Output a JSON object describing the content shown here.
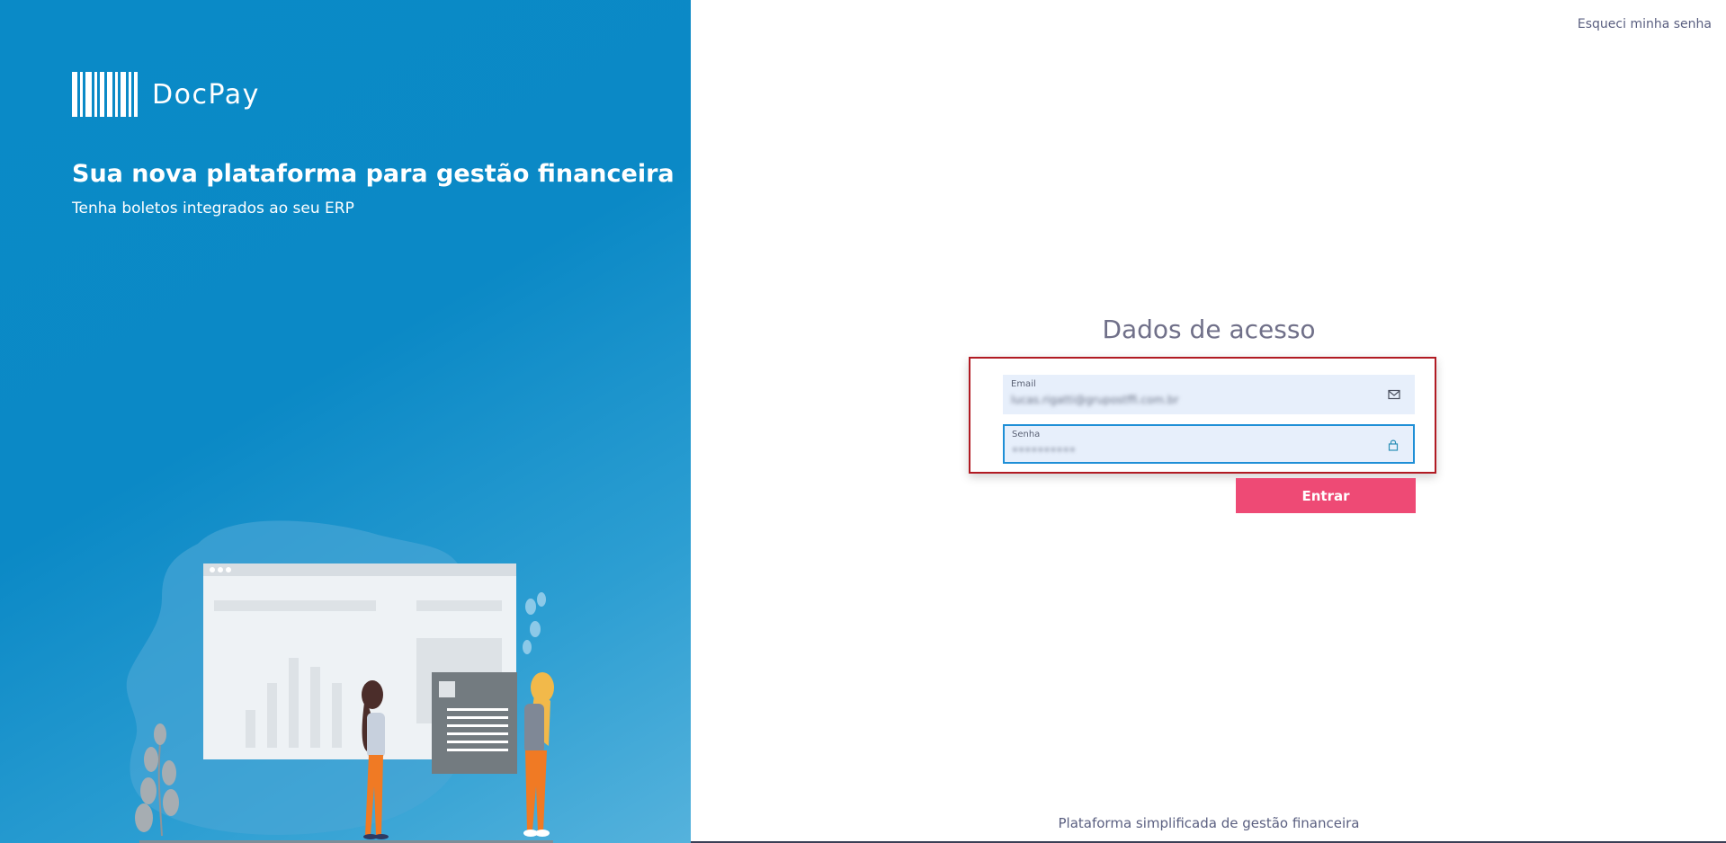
{
  "brand": {
    "name": "DocPay",
    "logo_icon": "barcode-logo"
  },
  "hero": {
    "headline": "Sua nova plataforma para gestão financeira",
    "subline": "Tenha boletos integrados ao seu ERP"
  },
  "header": {
    "forgot_password": "Esqueci minha senha"
  },
  "login": {
    "title": "Dados de acesso",
    "email": {
      "label": "Email",
      "value": "lucas.rigatti@grupostffi.com.br",
      "icon": "envelope-icon"
    },
    "password": {
      "label": "Senha",
      "value": "••••••••••",
      "icon": "lock-icon"
    },
    "submit_label": "Entrar"
  },
  "footer": {
    "text": "Plataforma simplificada de gestão financeira"
  },
  "colors": {
    "panel_blue": "#0a8ac7",
    "button_pink": "#ee4a75",
    "field_bg": "#e7effb",
    "focus_border": "#1f8fd6",
    "highlight_border": "#b11b23"
  }
}
